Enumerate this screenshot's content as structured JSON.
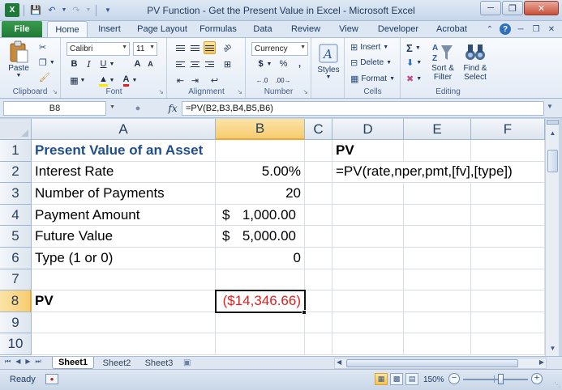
{
  "window": {
    "title": "PV Function - Get the Present Value in Excel  -  Microsoft Excel",
    "app_icon_letter": "X"
  },
  "tabs": {
    "file": "File",
    "items": [
      "Home",
      "Insert",
      "Page Layout",
      "Formulas",
      "Data",
      "Review",
      "View",
      "Developer",
      "Acrobat"
    ],
    "active": "Home"
  },
  "ribbon": {
    "clipboard": {
      "paste": "Paste",
      "label": "Clipboard"
    },
    "font": {
      "name": "Calibri",
      "size": "11",
      "label": "Font",
      "bold": "B",
      "italic": "I",
      "underline": "U",
      "grow": "A",
      "shrink": "A"
    },
    "alignment": {
      "label": "Alignment"
    },
    "number": {
      "format": "Currency",
      "currency": "$",
      "percent": "%",
      "comma": ",",
      "inc_dec": ".0→.00",
      "dec_dec": ".00→.0",
      "label": "Number"
    },
    "styles": {
      "label": "Styles"
    },
    "cells": {
      "insert": "Insert",
      "delete": "Delete",
      "format": "Format",
      "label": "Cells"
    },
    "editing": {
      "sum": "Σ",
      "sort_filter": "Sort & Filter",
      "find_select": "Find & Select",
      "label": "Editing"
    }
  },
  "formula_bar": {
    "name_box": "B8",
    "fx": "fx",
    "formula": "=PV(B2,B3,B4,B5,B6)"
  },
  "grid": {
    "columns": [
      "A",
      "B",
      "C",
      "D",
      "E",
      "F"
    ],
    "selected_column": "B",
    "rows": [
      "1",
      "2",
      "3",
      "4",
      "5",
      "6",
      "7",
      "8",
      "9",
      "10"
    ],
    "selected_row": "8",
    "cells": {
      "A1": "Present Value of an Asset",
      "A2": "Interest Rate",
      "A3": "Number of Payments",
      "A4": "Payment Amount",
      "A5": "Future Value",
      "A6": "Type (1 or 0)",
      "A8": "PV",
      "B2": "5.00%",
      "B3": "20",
      "B4_symbol": "$",
      "B4_value": "1,000.00",
      "B5_symbol": "$",
      "B5_value": "5,000.00",
      "B6": "0",
      "B8": "($14,346.66)",
      "D1": "PV",
      "D2": "=PV(rate,nper,pmt,[fv],[type])"
    }
  },
  "sheets": {
    "tabs": [
      "Sheet1",
      "Sheet2",
      "Sheet3"
    ],
    "active": "Sheet1"
  },
  "status": {
    "ready": "Ready",
    "zoom": "150%",
    "zoom_minus": "−",
    "zoom_plus": "+"
  },
  "colors": {
    "file_tab": "#1f7a36",
    "title_cell": "#1f4e8c",
    "negative_value": "#e02020",
    "selected_header": "#f7cc6f"
  }
}
